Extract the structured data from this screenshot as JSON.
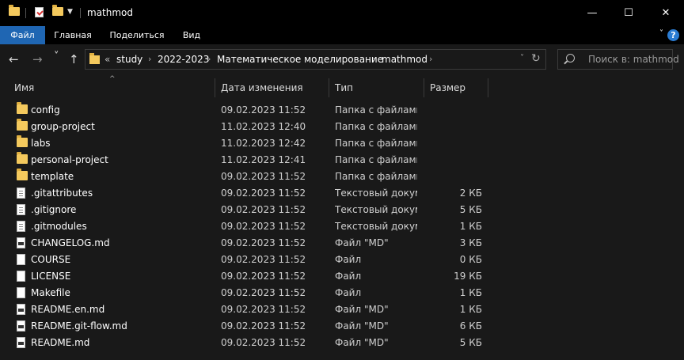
{
  "window": {
    "title": "mathmod",
    "minimize_icon": "—",
    "maximize_icon": "☐",
    "close_icon": "✕"
  },
  "ribbon": {
    "tabs": [
      {
        "label": "Файл",
        "active": true
      },
      {
        "label": "Главная",
        "active": false
      },
      {
        "label": "Поделиться",
        "active": false
      },
      {
        "label": "Вид",
        "active": false
      }
    ],
    "help": "?"
  },
  "nav": {
    "back": "←",
    "forward": "→",
    "recent": "˅",
    "up": "↑"
  },
  "address": {
    "overflow": "«",
    "crumbs": [
      "study",
      "2022-2023",
      "Математическое моделирование",
      "mathmod"
    ],
    "separator": "›"
  },
  "search": {
    "placeholder": "Поиск в: mathmod"
  },
  "columns": {
    "name": "Имя",
    "date": "Дата изменения",
    "type": "Тип",
    "size": "Размер"
  },
  "files": [
    {
      "icon": "folder-icon",
      "name": "config",
      "date": "09.02.2023 11:52",
      "type": "Папка с файлами",
      "size": ""
    },
    {
      "icon": "folder-icon",
      "name": "group-project",
      "date": "11.02.2023 12:40",
      "type": "Папка с файлами",
      "size": ""
    },
    {
      "icon": "folder-icon",
      "name": "labs",
      "date": "11.02.2023 12:42",
      "type": "Папка с файлами",
      "size": ""
    },
    {
      "icon": "folder-icon",
      "name": "personal-project",
      "date": "11.02.2023 12:41",
      "type": "Папка с файлами",
      "size": ""
    },
    {
      "icon": "folder-icon",
      "name": "template",
      "date": "09.02.2023 11:52",
      "type": "Папка с файлами",
      "size": ""
    },
    {
      "icon": "text-file-icon",
      "name": ".gitattributes",
      "date": "09.02.2023 11:52",
      "type": "Текстовый докум...",
      "size": "2 КБ"
    },
    {
      "icon": "text-file-icon",
      "name": ".gitignore",
      "date": "09.02.2023 11:52",
      "type": "Текстовый докум...",
      "size": "5 КБ"
    },
    {
      "icon": "text-file-icon",
      "name": ".gitmodules",
      "date": "09.02.2023 11:52",
      "type": "Текстовый докум...",
      "size": "1 КБ"
    },
    {
      "icon": "md-file-icon",
      "name": "CHANGELOG.md",
      "date": "09.02.2023 11:52",
      "type": "Файл \"MD\"",
      "size": "3 КБ"
    },
    {
      "icon": "file-icon",
      "name": "COURSE",
      "date": "09.02.2023 11:52",
      "type": "Файл",
      "size": "0 КБ"
    },
    {
      "icon": "file-icon",
      "name": "LICENSE",
      "date": "09.02.2023 11:52",
      "type": "Файл",
      "size": "19 КБ"
    },
    {
      "icon": "file-icon",
      "name": "Makefile",
      "date": "09.02.2023 11:52",
      "type": "Файл",
      "size": "1 КБ"
    },
    {
      "icon": "md-file-icon",
      "name": "README.en.md",
      "date": "09.02.2023 11:52",
      "type": "Файл \"MD\"",
      "size": "1 КБ"
    },
    {
      "icon": "md-file-icon",
      "name": "README.git-flow.md",
      "date": "09.02.2023 11:52",
      "type": "Файл \"MD\"",
      "size": "6 КБ"
    },
    {
      "icon": "md-file-icon",
      "name": "README.md",
      "date": "09.02.2023 11:52",
      "type": "Файл \"MD\"",
      "size": "5 КБ"
    }
  ]
}
